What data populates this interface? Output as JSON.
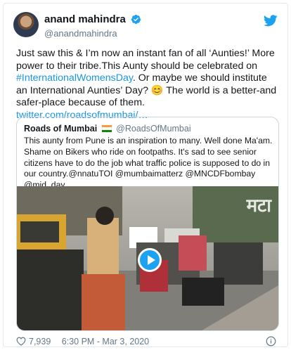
{
  "author": {
    "name": "anand mahindra",
    "handle": "@anandmahindra"
  },
  "tweet": {
    "text_1": "Just saw this & I’m now an instant fan of all ‘Aunties!’ More power to their tribe.This Aunty should be celebrated on ",
    "hashtag": "#InternationalWomensDay",
    "text_2": ". Or maybe we should institute an International Aunties’ Day? 😊 The world is a better-and safer-place because of them. ",
    "link": "twitter.com/roadsofmumbai/…"
  },
  "quoted": {
    "name": "Roads of Mumbai",
    "handle": "@RoadsOfMumbai",
    "text": "This aunty from Pune is an inspiration to many. Well done Ma'am. Shame on Bikers who ride on footpaths. It's sad to see senior citizens have to do the job what traffic police is supposed to do in our country.@nnatuTOI @mumbaimatterz @MNCDFbombay @mid_day",
    "video_watermark": "मटा"
  },
  "footer": {
    "likes": "7,939",
    "timestamp": "6:30 PM - Mar 3, 2020"
  },
  "colors": {
    "accent": "#1da1f2",
    "link": "#1b95e0",
    "verified": "#1da1f2"
  },
  "icons": [
    "verified-icon",
    "twitter-bird-icon",
    "india-flag-icon",
    "play-icon",
    "heart-icon",
    "info-icon"
  ]
}
